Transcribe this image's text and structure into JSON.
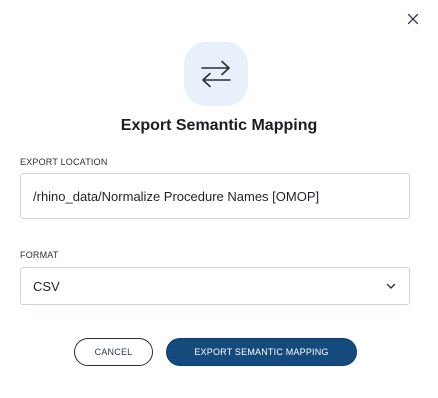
{
  "dialog": {
    "title": "Export Semantic Mapping",
    "icon": "swap-arrows-icon",
    "close_icon": "close-icon",
    "accent_color": "#154a7d",
    "icon_background": "#e8f0fb"
  },
  "location": {
    "label": "EXPORT LOCATION",
    "value": "/rhino_data/Normalize Procedure Names [OMOP]"
  },
  "format": {
    "label": "FORMAT",
    "selected": "CSV",
    "icon": "chevron-down-icon"
  },
  "actions": {
    "cancel_label": "CANCEL",
    "export_label": "EXPORT SEMANTIC MAPPING"
  }
}
